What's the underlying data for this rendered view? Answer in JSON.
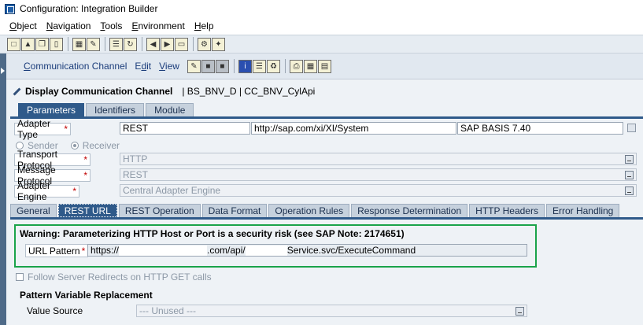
{
  "window": {
    "title": "Configuration: Integration Builder"
  },
  "menubar": {
    "items": [
      {
        "pre": "",
        "ul": "O",
        "post": "bject"
      },
      {
        "pre": "",
        "ul": "N",
        "post": "avigation"
      },
      {
        "pre": "",
        "ul": "T",
        "post": "ools"
      },
      {
        "pre": "",
        "ul": "E",
        "post": "nvironment"
      },
      {
        "pre": "",
        "ul": "H",
        "post": "elp"
      }
    ]
  },
  "subtoolbar": {
    "communication_channel": {
      "pre": "",
      "ul": "C",
      "post": "ommunication Channel"
    },
    "edit": {
      "pre": "E",
      "ul": "d",
      "post": "it"
    },
    "view": {
      "pre": "",
      "ul": "V",
      "post": "iew"
    }
  },
  "header": {
    "title": "Display Communication Channel",
    "object": "| BS_BNV_D | CC_BNV_CylApi"
  },
  "tabs_top": [
    "Parameters",
    "Identifiers",
    "Module"
  ],
  "adapter_type": {
    "label": "Adapter Type",
    "value": "REST",
    "namespace": "http://sap.com/xi/XI/System",
    "swcv": "SAP BASIS 7.40"
  },
  "direction": {
    "sender": "Sender",
    "receiver": "Receiver",
    "selected": "Receiver"
  },
  "transport_protocol": {
    "label": "Transport Protocol",
    "value": "HTTP"
  },
  "message_protocol": {
    "label": "Message Protocol",
    "value": "REST"
  },
  "adapter_engine": {
    "label": "Adapter Engine",
    "value": "Central Adapter Engine"
  },
  "required_marker": "*",
  "tabs_bottom": [
    "General",
    "REST URL",
    "REST Operation",
    "Data Format",
    "Operation Rules",
    "Response Determination",
    "HTTP Headers",
    "Error Handling"
  ],
  "rest_url": {
    "warning": "Warning: Parameterizing HTTP Host or Port is a security risk (see SAP Note: 2174651)",
    "url_label": "URL Pattern",
    "url_part1": "https://",
    "url_part2": ".com/api/",
    "url_part3": "Service.svc/ExecuteCommand"
  },
  "follow_redirects": "Follow Server Redirects on HTTP GET calls",
  "pattern_section": "Pattern Variable Replacement",
  "value_source": {
    "label": "Value Source",
    "value": "--- Unused ---"
  },
  "colors": {
    "accent": "#2f5a8a",
    "highlight_border": "#1aa34a",
    "required": "#c00000"
  }
}
